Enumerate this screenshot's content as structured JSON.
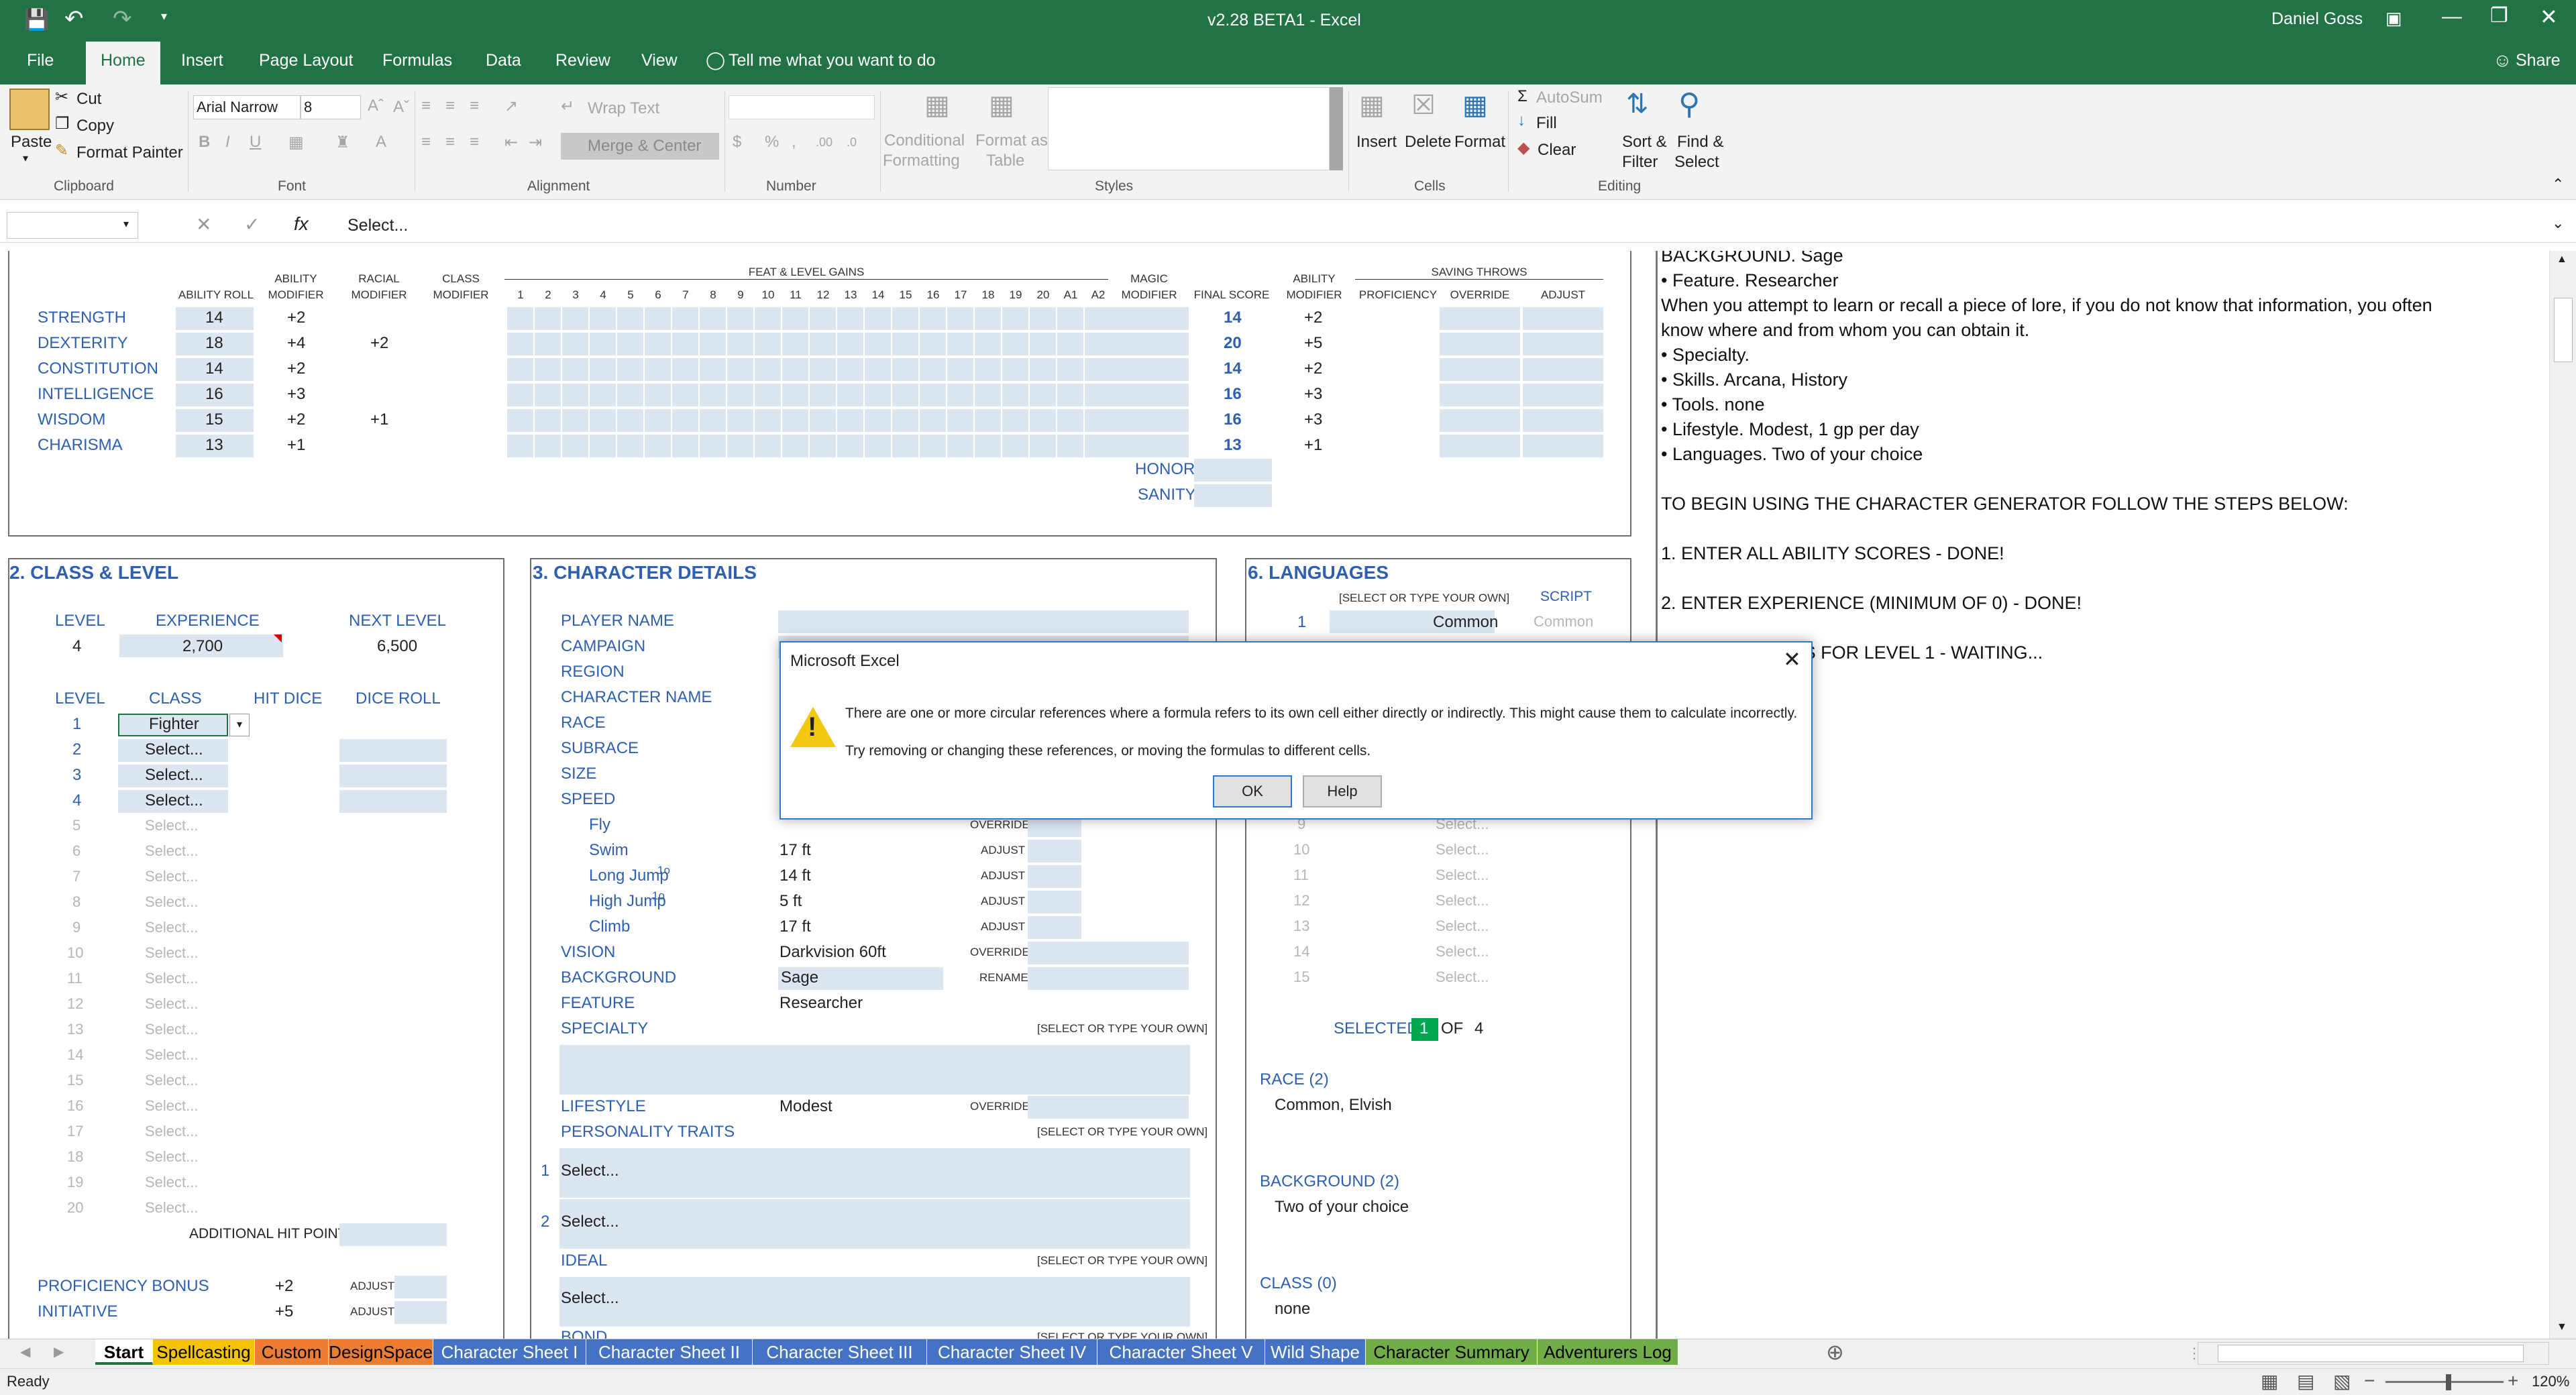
{
  "window": {
    "title": "v2.28 BETA1  -  Excel",
    "user": "Daniel Goss"
  },
  "ribbon_tabs": [
    "File",
    "Home",
    "Insert",
    "Page Layout",
    "Formulas",
    "Data",
    "Review",
    "View"
  ],
  "tell_me": "Tell me what you want to do",
  "share": "Share",
  "clipboard": {
    "paste": "Paste",
    "cut": "Cut",
    "copy": "Copy",
    "format_painter": "Format Painter",
    "label": "Clipboard"
  },
  "font": {
    "name": "Arial Narrow",
    "size": "8",
    "label": "Font"
  },
  "alignment": {
    "wrap": "Wrap Text",
    "merge": "Merge & Center",
    "label": "Alignment"
  },
  "number": {
    "label": "Number"
  },
  "styles": {
    "conditional": "Conditional",
    "formatting": "Formatting",
    "format_as": "Format as",
    "table": "Table",
    "label": "Styles"
  },
  "cells": {
    "insert": "Insert",
    "delete": "Delete",
    "format": "Format",
    "label": "Cells"
  },
  "editing": {
    "autosum": "AutoSum",
    "fill": "Fill",
    "clear": "Clear",
    "sort": "Sort &",
    "filter": "Filter",
    "find": "Find &",
    "select": "Select",
    "label": "Editing"
  },
  "formula_bar": {
    "value": "Select..."
  },
  "abilities": {
    "headers": {
      "roll": "ABILITY ROLL",
      "mod": "ABILITY",
      "mod2": "MODIFIER",
      "racial": "RACIAL",
      "class": "CLASS",
      "feat": "FEAT & LEVEL GAINS",
      "magic": "MAGIC",
      "final": "FINAL SCORE",
      "amod": "ABILITY",
      "saving": "SAVING THROWS",
      "prof": "PROFICIENCY",
      "override": "OVERRIDE",
      "adjust": "ADJUST"
    },
    "feat_cols": [
      "1",
      "2",
      "3",
      "4",
      "5",
      "6",
      "7",
      "8",
      "9",
      "10",
      "11",
      "12",
      "13",
      "14",
      "15",
      "16",
      "17",
      "18",
      "19",
      "20",
      "A1",
      "A2"
    ],
    "rows": [
      {
        "name": "STRENGTH",
        "roll": "14",
        "mod": "+2",
        "racial": "",
        "final": "14",
        "fmod": "+2"
      },
      {
        "name": "DEXTERITY",
        "roll": "18",
        "mod": "+4",
        "racial": "+2",
        "final": "20",
        "fmod": "+5"
      },
      {
        "name": "CONSTITUTION",
        "roll": "14",
        "mod": "+2",
        "racial": "",
        "final": "14",
        "fmod": "+2"
      },
      {
        "name": "INTELLIGENCE",
        "roll": "16",
        "mod": "+3",
        "racial": "",
        "final": "16",
        "fmod": "+3"
      },
      {
        "name": "WISDOM",
        "roll": "15",
        "mod": "+2",
        "racial": "+1",
        "final": "16",
        "fmod": "+3"
      },
      {
        "name": "CHARISMA",
        "roll": "13",
        "mod": "+1",
        "racial": "",
        "final": "13",
        "fmod": "+1"
      }
    ],
    "honor": "HONOR",
    "sanity": "SANITY"
  },
  "class_level": {
    "title": "2. CLASS & LEVEL",
    "level_lbl": "LEVEL",
    "exp_lbl": "EXPERIENCE",
    "next_lbl": "NEXT LEVEL",
    "level": "4",
    "exp": "2,700",
    "next": "6,500",
    "class_lbl": "CLASS",
    "hitdice_lbl": "HIT DICE",
    "diceroll_lbl": "DICE ROLL",
    "rows": [
      {
        "n": "1",
        "c": "Fighter"
      },
      {
        "n": "2",
        "c": "Select..."
      },
      {
        "n": "3",
        "c": "Select..."
      },
      {
        "n": "4",
        "c": "Select..."
      },
      {
        "n": "5",
        "c": "Select..."
      },
      {
        "n": "6",
        "c": "Select..."
      },
      {
        "n": "7",
        "c": "Select..."
      },
      {
        "n": "8",
        "c": "Select..."
      },
      {
        "n": "9",
        "c": "Select..."
      },
      {
        "n": "10",
        "c": "Select..."
      },
      {
        "n": "11",
        "c": "Select..."
      },
      {
        "n": "12",
        "c": "Select..."
      },
      {
        "n": "13",
        "c": "Select..."
      },
      {
        "n": "14",
        "c": "Select..."
      },
      {
        "n": "15",
        "c": "Select..."
      },
      {
        "n": "16",
        "c": "Select..."
      },
      {
        "n": "17",
        "c": "Select..."
      },
      {
        "n": "18",
        "c": "Select..."
      },
      {
        "n": "19",
        "c": "Select..."
      },
      {
        "n": "20",
        "c": "Select..."
      }
    ],
    "additional_hp": "ADDITIONAL  HIT POINTS",
    "prof_lbl": "PROFICIENCY BONUS",
    "prof": "+2",
    "init_lbl": "INITIATIVE",
    "init": "+5",
    "adjust": "ADJUST"
  },
  "character_details": {
    "title": "3. CHARACTER DETAILS",
    "labels": [
      "PLAYER NAME",
      "CAMPAIGN",
      "REGION",
      "CHARACTER NAME",
      "RACE",
      "SUBRACE",
      "SIZE",
      "SPEED"
    ],
    "speed": [
      {
        "l": "Fly",
        "v": "",
        "a": "OVERRIDE"
      },
      {
        "l": "Swim",
        "v": "17 ft",
        "a": "ADJUST"
      },
      {
        "l": "Long Jump",
        "v": "14 ft",
        "a": "ADJUST"
      },
      {
        "l": "High Jump",
        "v": "5 ft",
        "a": "ADJUST"
      },
      {
        "l": "Climb",
        "v": "17 ft",
        "a": "ADJUST"
      }
    ],
    "jump_sup": "1o",
    "vision_lbl": "VISION",
    "vision": "Darkvision 60ft",
    "override": "OVERRIDE",
    "background_lbl": "BACKGROUND",
    "background": "Sage",
    "rename": "RENAME",
    "feature_lbl": "FEATURE",
    "feature": "Researcher",
    "specialty_lbl": "SPECIALTY",
    "select_own": "[SELECT OR TYPE YOUR OWN]",
    "lifestyle_lbl": "LIFESTYLE",
    "lifestyle": "Modest",
    "traits_lbl": "PERSONALITY TRAITS",
    "trait1": "Select...",
    "trait2": "Select...",
    "ideal_lbl": "IDEAL",
    "ideal": "Select...",
    "bond_lbl": "BOND"
  },
  "languages": {
    "title": "6. LANGUAGES",
    "select_own": "[SELECT OR TYPE YOUR OWN]",
    "script_lbl": "SCRIPT",
    "first": {
      "n": "1",
      "lang": "Common",
      "script": "Common"
    },
    "rows": [
      {
        "n": "9",
        "v": "Select..."
      },
      {
        "n": "10",
        "v": "Select..."
      },
      {
        "n": "11",
        "v": "Select..."
      },
      {
        "n": "12",
        "v": "Select..."
      },
      {
        "n": "13",
        "v": "Select..."
      },
      {
        "n": "14",
        "v": "Select..."
      },
      {
        "n": "15",
        "v": "Select..."
      }
    ],
    "selected_lbl": "SELECTED",
    "selected": "1",
    "of": "OF",
    "total": "4",
    "race_lbl": "RACE (2)",
    "race": "Common, Elvish",
    "bg_lbl": "BACKGROUND (2)",
    "bg": "Two of your choice",
    "class_lbl": "CLASS (0)",
    "class": "none"
  },
  "notes": [
    "BACKGROUND. Sage",
    "• Feature. Researcher",
    " When you attempt to learn or recall a piece of lore, if you do not know that information, you often",
    " know where and from whom you can obtain it.",
    "• Specialty.",
    "• Skills. Arcana, History",
    "• Tools. none",
    "• Lifestyle. Modest, 1 gp per day",
    "• Languages. Two of your choice",
    "",
    "TO BEGIN USING THE CHARACTER GENERATOR FOLLOW THE STEPS BELOW:",
    "",
    "1. ENTER ALL ABILITY SCORES - DONE!",
    "",
    "2. ENTER EXPERIENCE (MINIMUM OF 0) - DONE!",
    "",
    "3. SELECT CLASS FOR LEVEL 1 - WAITING..."
  ],
  "dialog": {
    "title": "Microsoft Excel",
    "line1": "There are one or more circular references where a formula refers to its own cell either directly or indirectly. This might cause them to calculate incorrectly.",
    "line2": "Try removing or changing these references, or moving the formulas to different cells.",
    "ok": "OK",
    "help": "Help"
  },
  "sheet_tabs": [
    {
      "name": "Start",
      "color": "#ffffff",
      "text": "#000000"
    },
    {
      "name": "Spellcasting",
      "color": "#f5c400",
      "text": "#000000"
    },
    {
      "name": "Custom",
      "color": "#ed7d31",
      "text": "#000000"
    },
    {
      "name": "DesignSpace",
      "color": "#ed7d31",
      "text": "#000000"
    },
    {
      "name": "Character Sheet I",
      "color": "#4472c4",
      "text": "#ffffff"
    },
    {
      "name": "Character Sheet II",
      "color": "#4472c4",
      "text": "#ffffff"
    },
    {
      "name": "Character Sheet III",
      "color": "#4472c4",
      "text": "#ffffff"
    },
    {
      "name": "Character Sheet IV",
      "color": "#4472c4",
      "text": "#ffffff"
    },
    {
      "name": "Character Sheet V",
      "color": "#4472c4",
      "text": "#ffffff"
    },
    {
      "name": "Wild Shape",
      "color": "#4472c4",
      "text": "#ffffff"
    },
    {
      "name": "Character Summary",
      "color": "#70ad47",
      "text": "#000000"
    },
    {
      "name": "Adventurers Log",
      "color": "#70ad47",
      "text": "#000000"
    }
  ],
  "status": {
    "ready": "Ready",
    "zoom": "120%"
  },
  "colors": {
    "excel_green": "#217346",
    "label_blue": "#2e5fb0",
    "cell_fill": "#dce6f1"
  }
}
